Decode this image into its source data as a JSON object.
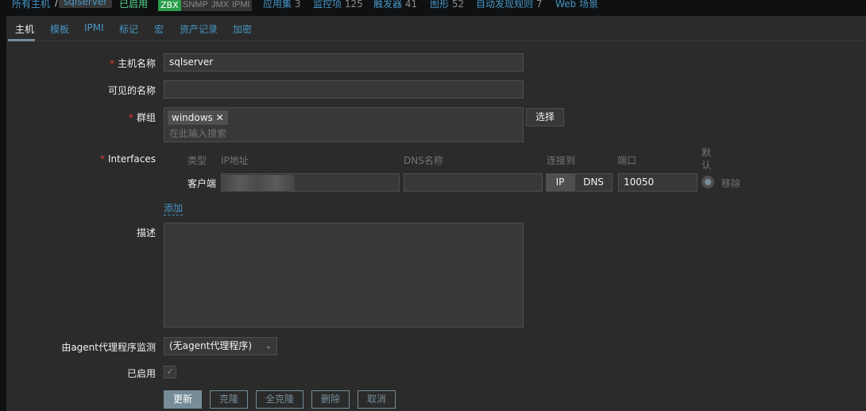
{
  "breadcrumb": {
    "all_hosts": "所有主机",
    "separator": "/",
    "host": "sqlserver"
  },
  "status": {
    "enabled": "已启用",
    "zbx": "ZBX",
    "snmp": "SNMP",
    "jmx": "JMX",
    "ipmi": "IPMI"
  },
  "nav": [
    {
      "label": "应用集",
      "count": "3"
    },
    {
      "label": "监控项",
      "count": "125"
    },
    {
      "label": "触发器",
      "count": "41"
    },
    {
      "label": "图形",
      "count": "52"
    },
    {
      "label": "自动发现规则",
      "count": "7"
    },
    {
      "label": "Web 场景",
      "count": ""
    }
  ],
  "tabs": [
    "主机",
    "模板",
    "IPMI",
    "标记",
    "宏",
    "资产记录",
    "加密"
  ],
  "form": {
    "host_name_label": "主机名称",
    "host_name": "sqlserver",
    "visible_name_label": "可见的名称",
    "visible_name": "",
    "groups_label": "群组",
    "group_tag": "windows",
    "group_placeholder": "在此输入搜索",
    "select_button": "选择",
    "interfaces_label": "Interfaces",
    "iface_headers": {
      "type": "类型",
      "ip": "IP地址",
      "dns": "DNS名称",
      "connect": "连接到",
      "port": "端口",
      "default": "默认"
    },
    "iface": {
      "type": "客户端",
      "ip": "",
      "dns": "",
      "ip_btn": "IP",
      "dns_btn": "DNS",
      "port": "10050",
      "remove": "移除"
    },
    "add_link": "添加",
    "description_label": "描述",
    "description": "",
    "proxy_label": "由agent代理程序监测",
    "proxy_value": "(无agent代理程序)",
    "enabled_label": "已启用",
    "enabled": true
  },
  "buttons": {
    "update": "更新",
    "clone": "克隆",
    "full_clone": "全克隆",
    "delete": "删除",
    "cancel": "取消"
  }
}
